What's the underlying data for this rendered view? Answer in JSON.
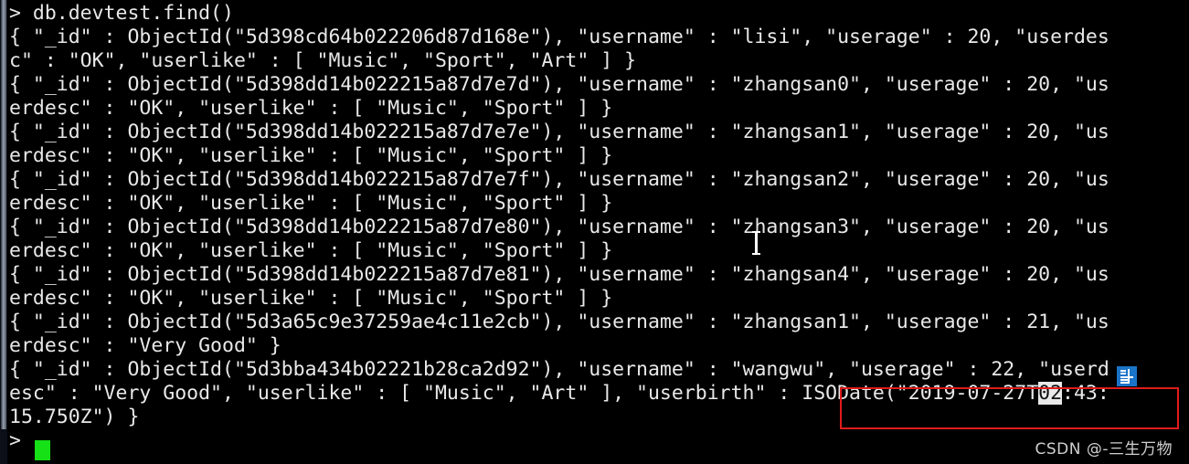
{
  "terminal": {
    "background_color": "#000000",
    "foreground_color": "#e8e8e8",
    "caret_color": "#16e016",
    "selection_bg_color": "#e9e9e9",
    "selection_fg_color": "#111111",
    "annotation_color": "#e01b1b",
    "ime_color": "#1a74c8",
    "prompt_symbol": ">",
    "command": "db.devtest.find()"
  },
  "lines": [
    {
      "id": "prompt-command",
      "text": "> db.devtest.find()"
    },
    {
      "id": "doc1-a",
      "text": "{ \"_id\" : ObjectId(\"5d398cd64b022206d87d168e\"), \"username\" : \"lisi\", \"userage\" : 20, \"userdes"
    },
    {
      "id": "doc1-b",
      "text": "c\" : \"OK\", \"userlike\" : [ \"Music\", \"Sport\", \"Art\" ] }"
    },
    {
      "id": "doc2-a",
      "text": "{ \"_id\" : ObjectId(\"5d398dd14b022215a87d7e7d\"), \"username\" : \"zhangsan0\", \"userage\" : 20, \"us"
    },
    {
      "id": "doc2-b",
      "text": "erdesc\" : \"OK\", \"userlike\" : [ \"Music\", \"Sport\" ] }"
    },
    {
      "id": "doc3-a",
      "text": "{ \"_id\" : ObjectId(\"5d398dd14b022215a87d7e7e\"), \"username\" : \"zhangsan1\", \"userage\" : 20, \"us"
    },
    {
      "id": "doc3-b",
      "text": "erdesc\" : \"OK\", \"userlike\" : [ \"Music\", \"Sport\" ] }"
    },
    {
      "id": "doc4-a",
      "text": "{ \"_id\" : ObjectId(\"5d398dd14b022215a87d7e7f\"), \"username\" : \"zhangsan2\", \"userage\" : 20, \"us"
    },
    {
      "id": "doc4-b",
      "text": "erdesc\" : \"OK\", \"userlike\" : [ \"Music\", \"Sport\" ] }"
    },
    {
      "id": "doc5-a",
      "text": "{ \"_id\" : ObjectId(\"5d398dd14b022215a87d7e80\"), \"username\" : \"zhangsan3\", \"userage\" : 20, \"us"
    },
    {
      "id": "doc5-b",
      "text": "erdesc\" : \"OK\", \"userlike\" : [ \"Music\", \"Sport\" ] }"
    },
    {
      "id": "doc6-a",
      "text": "{ \"_id\" : ObjectId(\"5d398dd14b022215a87d7e81\"), \"username\" : \"zhangsan4\", \"userage\" : 20, \"us"
    },
    {
      "id": "doc6-b",
      "text": "erdesc\" : \"OK\", \"userlike\" : [ \"Music\", \"Sport\" ] }"
    },
    {
      "id": "doc7-a",
      "text": "{ \"_id\" : ObjectId(\"5d3a65c9e37259ae4c11e2cb\"), \"username\" : \"zhangsan1\", \"userage\" : 21, \"us"
    },
    {
      "id": "doc7-b",
      "text": "erdesc\" : \"Very Good\" }"
    },
    {
      "id": "doc8-a",
      "text": "{ \"_id\" : ObjectId(\"5d3bba434b02221b28ca2d92\"), \"username\" : \"wangwu\", \"userage\" : 22, \"userd"
    }
  ],
  "highlighted_line": {
    "id": "doc8-b",
    "prefix": "esc\" : \"Very Good\", \"userlike\" : [ \"Music\", \"Art\" ], \"userbirth\" : ISODate(\"2019-07-27T",
    "selected": "02",
    "suffix": ":43:"
  },
  "tail_lines": [
    {
      "id": "doc8-c",
      "text": "15.750Z\") }"
    },
    {
      "id": "final-prompt",
      "text": ">"
    }
  ],
  "documents": [
    {
      "_id": "5d398cd64b022206d87d168e",
      "username": "lisi",
      "userage": 20,
      "userdesc": "OK",
      "userlike": [
        "Music",
        "Sport",
        "Art"
      ]
    },
    {
      "_id": "5d398dd14b022215a87d7e7d",
      "username": "zhangsan0",
      "userage": 20,
      "userdesc": "OK",
      "userlike": [
        "Music",
        "Sport"
      ]
    },
    {
      "_id": "5d398dd14b022215a87d7e7e",
      "username": "zhangsan1",
      "userage": 20,
      "userdesc": "OK",
      "userlike": [
        "Music",
        "Sport"
      ]
    },
    {
      "_id": "5d398dd14b022215a87d7e7f",
      "username": "zhangsan2",
      "userage": 20,
      "userdesc": "OK",
      "userlike": [
        "Music",
        "Sport"
      ]
    },
    {
      "_id": "5d398dd14b022215a87d7e80",
      "username": "zhangsan3",
      "userage": 20,
      "userdesc": "OK",
      "userlike": [
        "Music",
        "Sport"
      ]
    },
    {
      "_id": "5d398dd14b022215a87d7e81",
      "username": "zhangsan4",
      "userage": 20,
      "userdesc": "OK",
      "userlike": [
        "Music",
        "Sport"
      ]
    },
    {
      "_id": "5d3a65c9e37259ae4c11e2cb",
      "username": "zhangsan1",
      "userage": 21,
      "userdesc": "Very Good"
    },
    {
      "_id": "5d3bba434b02221b28ca2d92",
      "username": "wangwu",
      "userage": 22,
      "userdesc": "Very Good",
      "userlike": [
        "Music",
        "Art"
      ],
      "userbirth": "ISODate(\"2019-07-27T02:43:15.750Z\")"
    }
  ],
  "watermark": {
    "text": "CSDN @-三生万物"
  }
}
